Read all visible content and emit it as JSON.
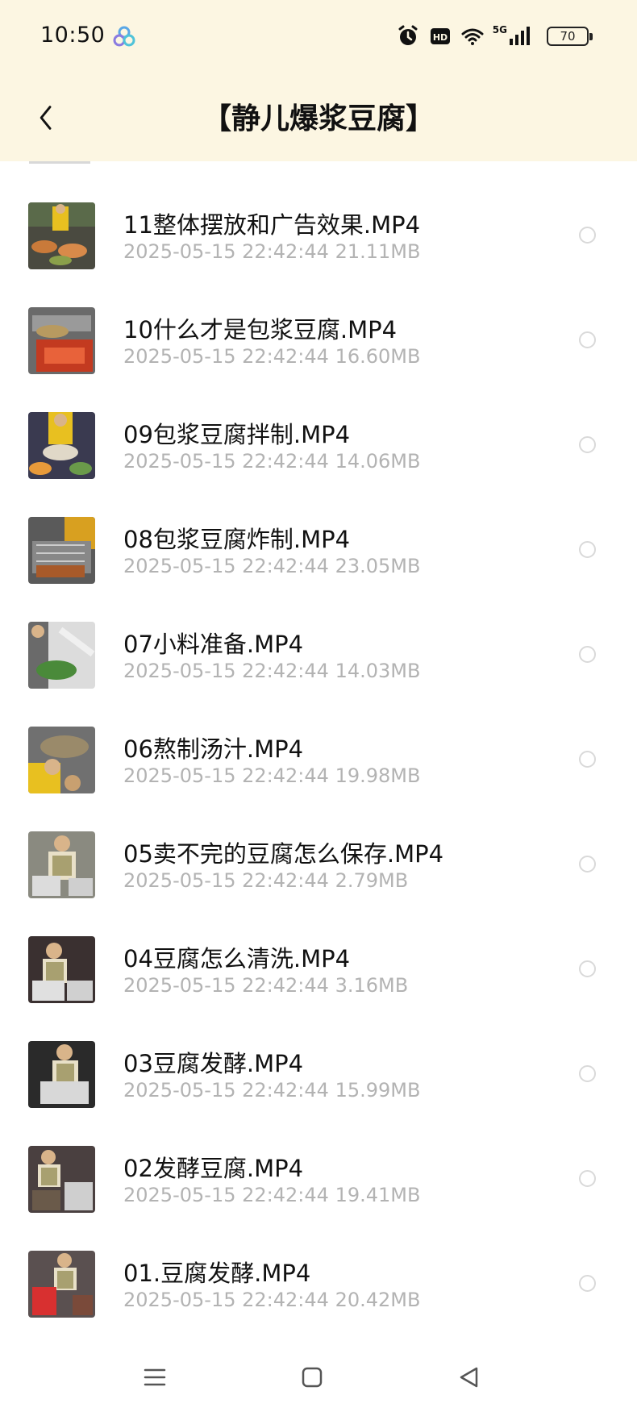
{
  "status": {
    "time": "10:50",
    "hd": "HD",
    "network": "5G",
    "battery": "70"
  },
  "header": {
    "title": "【静儿爆浆豆腐】"
  },
  "files": [
    {
      "name": "11整体摆放和广告效果.MP4",
      "date": "2025-05-15",
      "time": "22:42:44",
      "size": "21.11MB"
    },
    {
      "name": "10什么才是包浆豆腐.MP4",
      "date": "2025-05-15",
      "time": "22:42:44",
      "size": "16.60MB"
    },
    {
      "name": "09包浆豆腐拌制.MP4",
      "date": "2025-05-15",
      "time": "22:42:44",
      "size": "14.06MB"
    },
    {
      "name": "08包浆豆腐炸制.MP4",
      "date": "2025-05-15",
      "time": "22:42:44",
      "size": "23.05MB"
    },
    {
      "name": "07小料准备.MP4",
      "date": "2025-05-15",
      "time": "22:42:44",
      "size": "14.03MB"
    },
    {
      "name": "06熬制汤汁.MP4",
      "date": "2025-05-15",
      "time": "22:42:44",
      "size": "19.98MB"
    },
    {
      "name": "05卖不完的豆腐怎么保存.MP4",
      "date": "2025-05-15",
      "time": "22:42:44",
      "size": "2.79MB"
    },
    {
      "name": "04豆腐怎么清洗.MP4",
      "date": "2025-05-15",
      "time": "22:42:44",
      "size": "3.16MB"
    },
    {
      "name": "03豆腐发酵.MP4",
      "date": "2025-05-15",
      "time": "22:42:44",
      "size": "15.99MB"
    },
    {
      "name": "02发酵豆腐.MP4",
      "date": "2025-05-15",
      "time": "22:42:44",
      "size": "19.41MB"
    },
    {
      "name": "01.豆腐发酵.MP4",
      "date": "2025-05-15",
      "time": "22:42:44",
      "size": "20.42MB"
    }
  ],
  "icons": {
    "back": "chevron-left-icon",
    "menu": "menu-icon",
    "home": "home-square-icon",
    "nav_back": "triangle-back-icon"
  },
  "colors": {
    "header_bg": "#fcf6e2",
    "meta_text": "#b3b3b3",
    "radio_border": "#d9d9d9"
  }
}
